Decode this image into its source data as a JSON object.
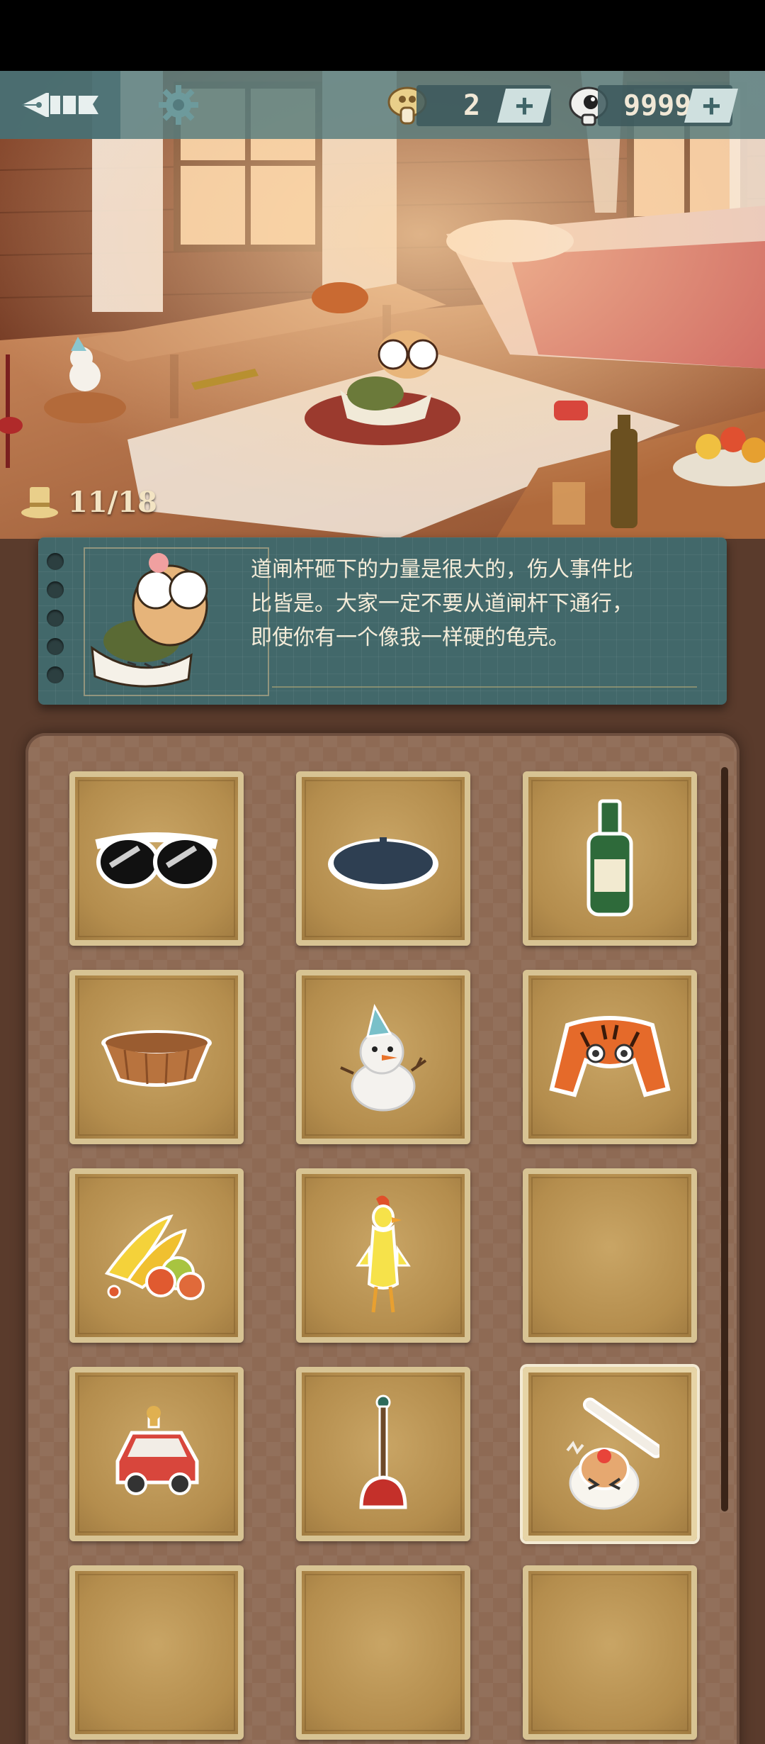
{
  "header": {
    "currency_mushroom": {
      "value": "2",
      "icon": "mushroom-coin-icon"
    },
    "currency_eye": {
      "value": "9999",
      "icon": "eyeball-coin-icon"
    },
    "back_icon": "pen-nib-back-icon",
    "settings_icon": "gear-icon"
  },
  "progress": {
    "icon": "top-hat-icon",
    "text": "11/18"
  },
  "dialog": {
    "text": "道闸杆砸下的力量是很大的，伤人事件比比皆是。大家一定不要从道闸杆下通行，即使你有一个像我一样硬的龟壳。"
  },
  "inventory": {
    "items": [
      {
        "name": "sunglasses",
        "empty": false
      },
      {
        "name": "beret",
        "empty": false
      },
      {
        "name": "green-bottle",
        "empty": false
      },
      {
        "name": "basket",
        "empty": false
      },
      {
        "name": "snowman",
        "empty": false
      },
      {
        "name": "tiger-hat",
        "empty": false
      },
      {
        "name": "fruits",
        "empty": false
      },
      {
        "name": "rubber-chicken",
        "empty": false
      },
      {
        "name": "empty",
        "empty": true
      },
      {
        "name": "toy-car",
        "empty": false
      },
      {
        "name": "plunger",
        "empty": false
      },
      {
        "name": "hit-turtle",
        "empty": false,
        "selected": true
      },
      {
        "name": "empty",
        "empty": true
      },
      {
        "name": "empty",
        "empty": true
      },
      {
        "name": "empty",
        "empty": true
      }
    ]
  },
  "colors": {
    "topbar": "#547b7e",
    "dialog_bg": "#42686a",
    "panel_bg": "#8e6a54",
    "slot_border": "#d7c393"
  }
}
